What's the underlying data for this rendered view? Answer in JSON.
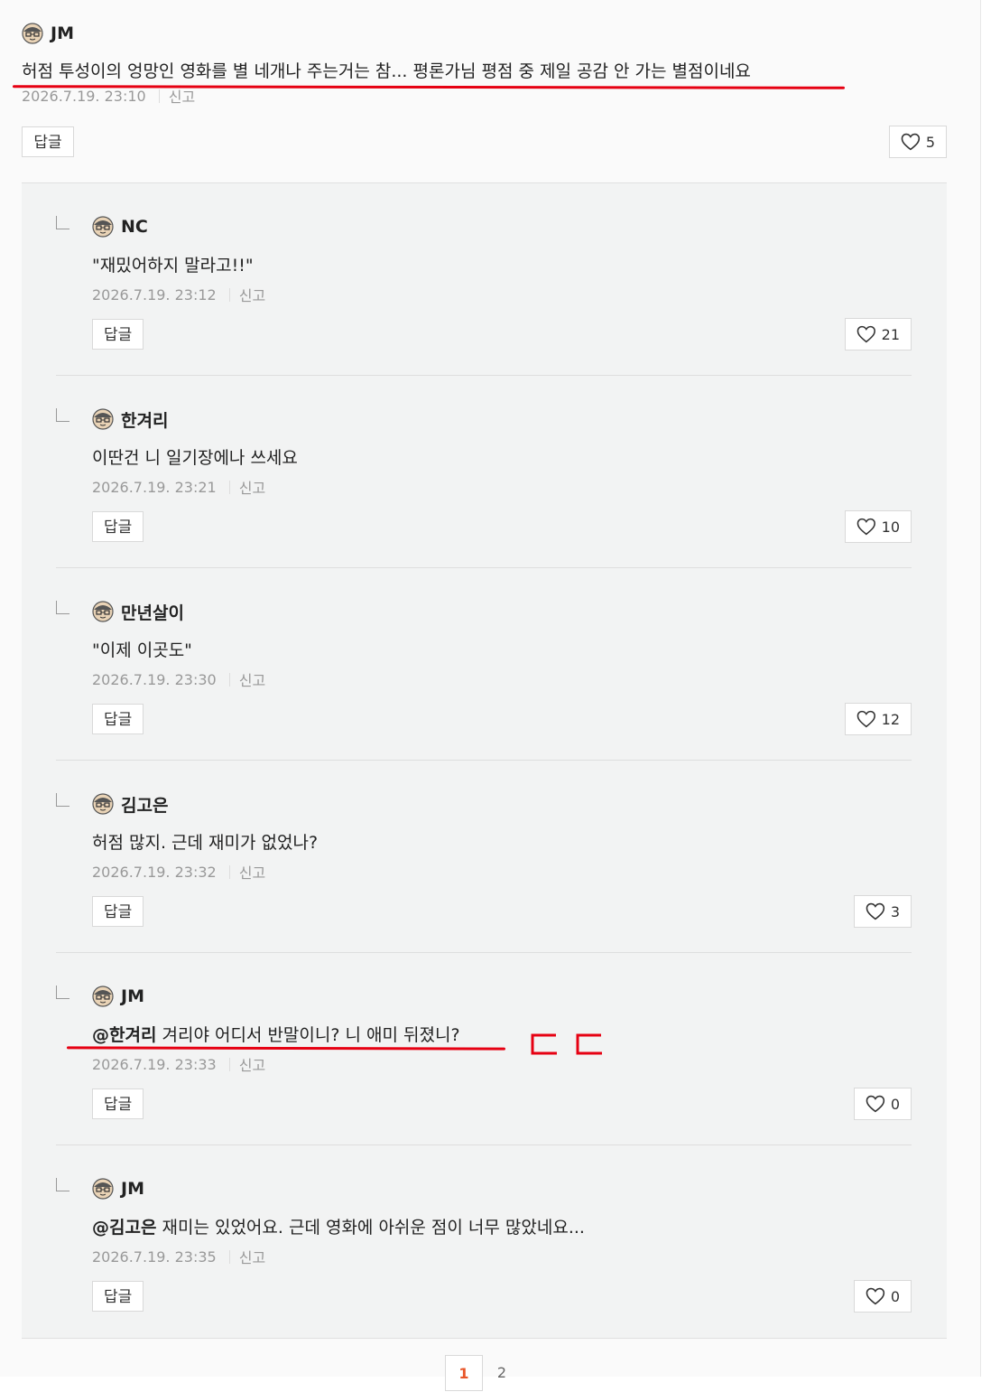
{
  "top_comment": {
    "author": "JM",
    "content": "허점 투성이의 엉망인 영화를 별 네개나 주는거는 참... 평론가님 평점 중 제일 공감 안 가는 별점이네요",
    "date": "2026.7.19. 23:10",
    "report": "신고",
    "reply_label": "답글",
    "likes": "5"
  },
  "replies": [
    {
      "author": "NC",
      "mention": "",
      "content": "\"재밌어하지 말라고!!\"",
      "date": "2026.7.19. 23:12",
      "report": "신고",
      "reply_label": "답글",
      "likes": "21"
    },
    {
      "author": "한겨리",
      "mention": "",
      "content": "이딴건 니 일기장에나 쓰세요",
      "date": "2026.7.19. 23:21",
      "report": "신고",
      "reply_label": "답글",
      "likes": "10"
    },
    {
      "author": "만년살이",
      "mention": "",
      "content": "\"이제 이곳도\"",
      "date": "2026.7.19. 23:30",
      "report": "신고",
      "reply_label": "답글",
      "likes": "12"
    },
    {
      "author": "김고은",
      "mention": "",
      "content": "허점 많지. 근데 재미가 없었나?",
      "date": "2026.7.19. 23:32",
      "report": "신고",
      "reply_label": "답글",
      "likes": "3"
    },
    {
      "author": "JM",
      "mention": "@한겨리",
      "content": " 겨리야 어디서 반말이니? 니 애미 뒤졌니?",
      "date": "2026.7.19. 23:33",
      "report": "신고",
      "reply_label": "답글",
      "likes": "0"
    },
    {
      "author": "JM",
      "mention": "@김고은",
      "content": " 재미는 있었어요. 근데 영화에 아쉬운 점이 너무 많았네요...",
      "date": "2026.7.19. 23:35",
      "report": "신고",
      "reply_label": "답글",
      "likes": "0"
    }
  ],
  "pagination": {
    "current": "1",
    "next": "2"
  },
  "annotation": {
    "color": "#e60012",
    "marks": "ㄷㄷ"
  },
  "colors": {
    "page_bg": "#fafafa",
    "replies_bg": "#f2f3f3",
    "accent": "#e8562a"
  }
}
